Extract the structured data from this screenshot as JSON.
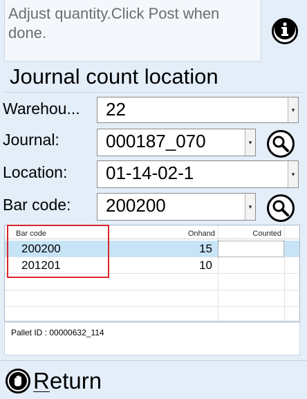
{
  "instructions": {
    "text": "Adjust quantity.Click Post when done."
  },
  "page": {
    "title": "Journal count location"
  },
  "fields": {
    "warehouse": {
      "label": "Warehou...",
      "value": "22"
    },
    "journal": {
      "label": "Journal:",
      "value": "000187_070"
    },
    "location": {
      "label": "Location:",
      "value": "01-14-02-1"
    },
    "barcode": {
      "label": "Bar code:",
      "value": "200200"
    }
  },
  "grid": {
    "columns": [
      "Bar code",
      "Onhand",
      "Counted"
    ],
    "rows": [
      {
        "barcode": "200200",
        "onhand": "15",
        "counted": ""
      },
      {
        "barcode": "201201",
        "onhand": "10",
        "counted": ""
      }
    ]
  },
  "pallet": {
    "text": "Pallet ID : 00000632_114"
  },
  "footer": {
    "return_label_first": "R",
    "return_label_rest": "eturn"
  },
  "icons": {
    "info": "info-icon",
    "search": "magnifier-icon",
    "return": "stop-hand-icon",
    "dropdown": "chevron-down-icon"
  },
  "colors": {
    "background": "#e3eef9",
    "selected_row": "#c7e3f6",
    "highlight_box": "#d9262b"
  }
}
